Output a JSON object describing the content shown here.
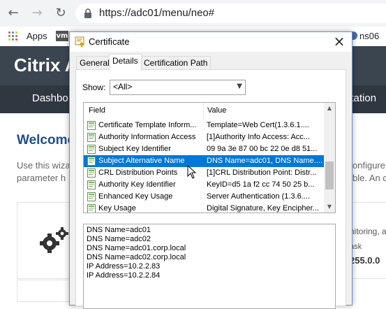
{
  "browser": {
    "url": "https://adc01/menu/neo#",
    "bookmarks": {
      "apps_label": "Apps",
      "vm_label": "vm",
      "ns06_label": "ns06"
    }
  },
  "background_page": {
    "logo": "Citrix A",
    "nav": {
      "item1": "Dashbo",
      "item2": "ntation"
    },
    "welcome": "Welcome",
    "text_line1_left": "Use this wiza",
    "text_line1_right": "onfigure or",
    "text_line2_left": "parameter h",
    "text_line2_right": "ble. An ora",
    "right_card_line1": "nitoring, a",
    "right_card_line2": "ask",
    "right_card_value": "255.0.0"
  },
  "dialog": {
    "title": "Certificate",
    "tabs": [
      "General",
      "Details",
      "Certification Path"
    ],
    "active_tab": "Details",
    "show_label": "Show:",
    "show_value": "<All>",
    "columns": {
      "field": "Field",
      "value": "Value"
    },
    "rows": [
      {
        "field": "Certificate Template Inform...",
        "value": "Template=Web Cert(1.3.6.1...."
      },
      {
        "field": "Authority Information Access",
        "value": "[1]Authority Info Access: Acc..."
      },
      {
        "field": "Subject Key Identifier",
        "value": "09 9a 3e 87 00 bc 22 0e d8 51..."
      },
      {
        "field": "Subject Alternative Name",
        "value": "DNS Name=adc01, DNS Name...."
      },
      {
        "field": "CRL Distribution Points",
        "value": "[1]CRL Distribution Point: Distr..."
      },
      {
        "field": "Authority Key Identifier",
        "value": "KeyID=d5 1a f2 cc 74 50 25 b..."
      },
      {
        "field": "Enhanced Key Usage",
        "value": "Server Authentication (1.3.6...."
      },
      {
        "field": "Key Usage",
        "value": "Digital Signature, Key Encipher..."
      }
    ],
    "selected_row": "Subject Alternative Name",
    "detail_lines": [
      "DNS Name=adc01",
      "DNS Name=adc02",
      "DNS Name=adc01.corp.local",
      "DNS Name=adc02.corp.local",
      "IP Address=10.2.2.83",
      "IP Address=10.2.2.84"
    ]
  },
  "colors": {
    "selection": "#0078d7",
    "citrix_header": "#3b4550",
    "citrix_nav": "#2f3841",
    "welcome": "#1f4e8c"
  }
}
